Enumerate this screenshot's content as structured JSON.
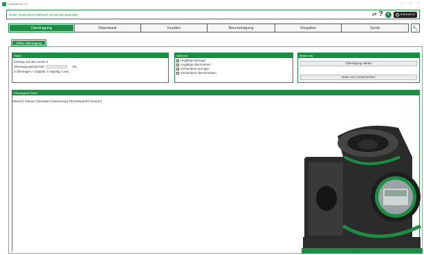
{
  "window": {
    "title": "Dual/Autom 1.6",
    "controls": [
      "–",
      "□",
      "×"
    ]
  },
  "device_bar": {
    "text": "Gerät: SmartCheck SMRNO® 10-160 Nm   52603001",
    "icons": [
      "swap-icon",
      "help-icon",
      "info-icon"
    ],
    "logo_text": "STAHLWILLE"
  },
  "tabs": [
    {
      "label": "Übertragung",
      "active": true
    },
    {
      "label": "Datenbank",
      "active": false
    },
    {
      "label": "Kunden",
      "active": false
    },
    {
      "label": "Bescheinigung",
      "active": false
    },
    {
      "label": "Vorgaben",
      "active": false
    },
    {
      "label": "Gerät",
      "active": false
    }
  ],
  "subtab": {
    "label": "Offline Übertragung"
  },
  "status": {
    "title": "Status",
    "entries_label": "Einträge auf dem Gerät: 0",
    "progress_label": "Übertragungsfortschritt",
    "progress_value": 0,
    "progress_text": "0%",
    "summary": "0 Übertragen, 0 doppelt, 0 ungültig, 0 neu"
  },
  "options": {
    "title": "Optionen",
    "items": [
      {
        "label": "Ungültige anzeigen",
        "checked": true
      },
      {
        "label": "Ungültige übernehmen",
        "checked": false
      },
      {
        "label": "Vorhandene anzeigen",
        "checked": true
      },
      {
        "label": "Vorhandene überschreiben",
        "checked": false
      }
    ]
  },
  "operation": {
    "title": "Bedienung",
    "start_button": "Übertragung starten",
    "delete_button": "Daten vom Gerät löschen"
  },
  "transferred": {
    "title": "Übertragene Daten",
    "columns": [
      "Sollwert",
      "Toleranz",
      "Messwert",
      "Bewertung",
      "Messzeitpunkt",
      "Hinweis"
    ]
  },
  "colors": {
    "accent": "#1f8c43",
    "border": "#555555"
  }
}
